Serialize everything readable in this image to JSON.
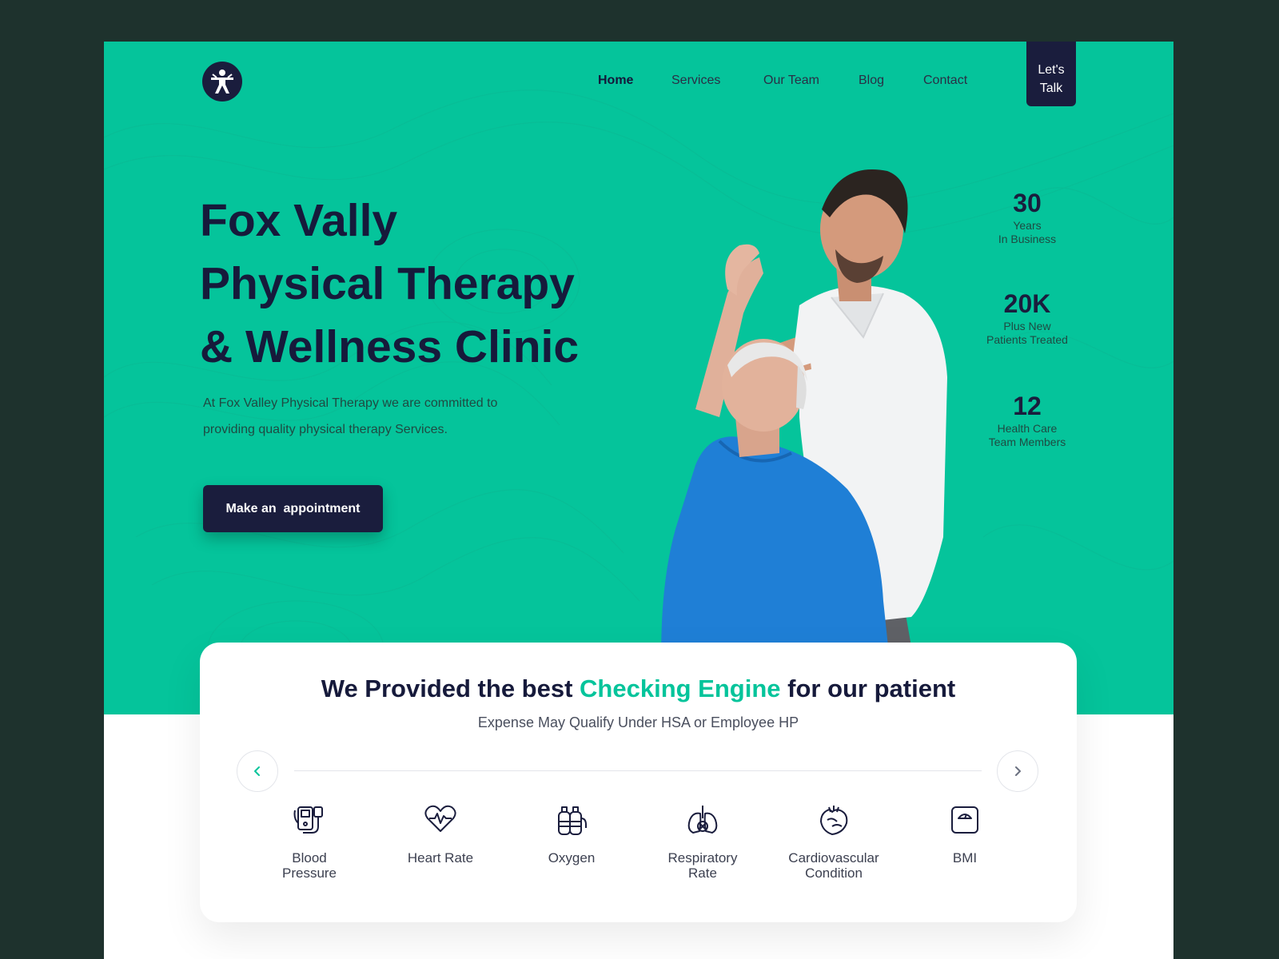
{
  "nav": {
    "items": [
      {
        "label": "Home",
        "active": true
      },
      {
        "label": "Services",
        "active": false
      },
      {
        "label": "Our Team",
        "active": false
      },
      {
        "label": "Blog",
        "active": false
      },
      {
        "label": "Contact",
        "active": false
      }
    ],
    "cta_label": "Let's\nTalk"
  },
  "hero": {
    "title_lines": [
      "Fox Vally",
      "Physical Therapy",
      "& Wellness Clinic"
    ],
    "description": "At Fox Valley Physical Therapy we are committed to providing quality physical therapy Services.",
    "button_label": "Make an  appointment"
  },
  "stats": [
    {
      "value": "30",
      "label": "Years\nIn Business"
    },
    {
      "value": "20K",
      "label": "Plus New\nPatients Treated"
    },
    {
      "value": "12",
      "label": "Health Care\nTeam Members"
    }
  ],
  "engine": {
    "title_before": "We Provided the best ",
    "title_accent": "Checking Engine",
    "title_after": " for our patient",
    "subtitle": "Expense May Qualify Under HSA or Employee HP",
    "metrics": [
      {
        "label": "Blood\nPressure",
        "icon": "blood-pressure-icon"
      },
      {
        "label": "Heart Rate",
        "icon": "heart-rate-icon"
      },
      {
        "label": "Oxygen",
        "icon": "oxygen-tank-icon"
      },
      {
        "label": "Respiratory\nRate",
        "icon": "lungs-icon"
      },
      {
        "label": "Cardiovascular\nCondition",
        "icon": "heart-organ-icon"
      },
      {
        "label": "BMI",
        "icon": "weight-scale-icon"
      }
    ]
  },
  "colors": {
    "accent": "#05c49b",
    "navy": "#1a1d3d",
    "background": "#1e322d"
  }
}
